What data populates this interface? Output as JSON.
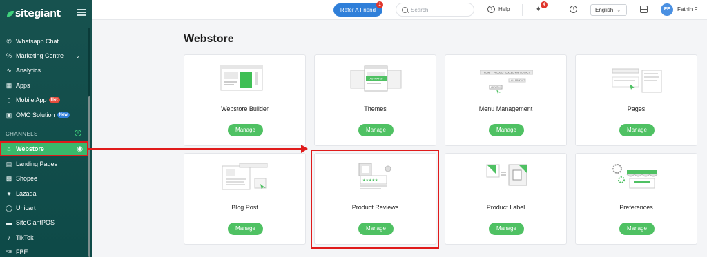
{
  "app": {
    "brand": "sitegiant"
  },
  "sidebar": {
    "items": [
      {
        "label": "Whatsapp Chat",
        "icon": "whatsapp-icon"
      },
      {
        "label": "Marketing Centre",
        "icon": "percent-icon"
      },
      {
        "label": "Analytics",
        "icon": "analytics-icon"
      },
      {
        "label": "Apps",
        "icon": "apps-icon"
      },
      {
        "label": "Mobile App",
        "icon": "mobile-icon",
        "badge": "Hot"
      },
      {
        "label": "OMO Solution",
        "icon": "omo-icon",
        "badge": "New"
      }
    ],
    "section_label": "CHANNELS",
    "channels": [
      {
        "label": "Webstore",
        "icon": "store-icon",
        "active": true
      },
      {
        "label": "Landing Pages",
        "icon": "landing-icon"
      },
      {
        "label": "Shopee",
        "icon": "shopee-icon"
      },
      {
        "label": "Lazada",
        "icon": "lazada-icon"
      },
      {
        "label": "Unicart",
        "icon": "unicart-icon"
      },
      {
        "label": "SiteGiantPOS",
        "icon": "pos-icon"
      },
      {
        "label": "TikTok",
        "icon": "tiktok-icon"
      },
      {
        "label": "FBE",
        "icon": "fbe-icon"
      }
    ]
  },
  "topbar": {
    "refer_label": "Refer A Friend",
    "refer_count": "1",
    "search_placeholder": "Search",
    "help_label": "Help",
    "notif_count": "4",
    "language": "English",
    "avatar_initials": "FF",
    "user_name": "Fathin F"
  },
  "main": {
    "title": "Webstore",
    "manage_label": "Manage",
    "cards": [
      {
        "label": "Webstore Builder"
      },
      {
        "label": "Themes"
      },
      {
        "label": "Menu Management"
      },
      {
        "label": "Pages"
      },
      {
        "label": "Blog Post"
      },
      {
        "label": "Product Reviews"
      },
      {
        "label": "Product Label"
      },
      {
        "label": "Preferences"
      }
    ]
  },
  "illus_text": {
    "themes_tag": "ACTIVATED",
    "menu_items": [
      "HOME",
      "PRODUCT",
      "COLLECTION",
      "CONTACT"
    ],
    "menu_sub": "ALL PRODUCT",
    "menu_add": "ABOUT US"
  },
  "colors": {
    "accent": "#4fc163",
    "sidebar": "#17524f",
    "annotation": "#e01b1b",
    "refer": "#2f7fd9"
  }
}
